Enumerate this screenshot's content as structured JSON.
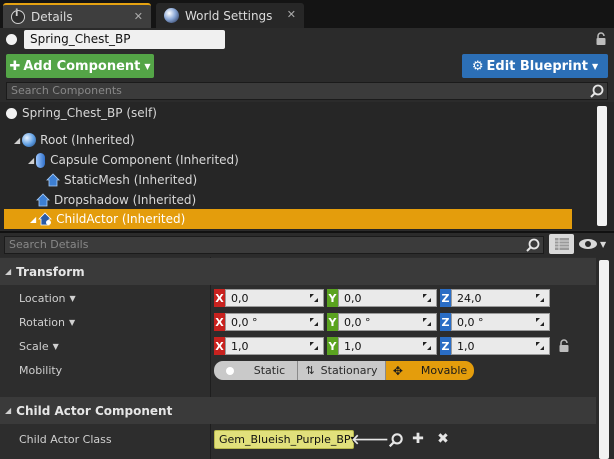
{
  "tabs": [
    {
      "label": "Details",
      "icon": "details-icon",
      "active": true
    },
    {
      "label": "World Settings",
      "icon": "globe-icon",
      "active": false
    }
  ],
  "actor": {
    "name": "Spring_Chest_BP"
  },
  "toolbar": {
    "add_component": "Add Component",
    "edit_blueprint": "Edit Blueprint"
  },
  "component_search": {
    "placeholder": "Search Components"
  },
  "components": [
    {
      "label": "Spring_Chest_BP (self)"
    },
    {
      "label": "Root (Inherited)"
    },
    {
      "label": "Capsule Component (Inherited)"
    },
    {
      "label": "StaticMesh (Inherited)"
    },
    {
      "label": "Dropshadow (Inherited)"
    },
    {
      "label": "ChildActor (Inherited)",
      "selected": true
    }
  ],
  "details_search": {
    "placeholder": "Search Details"
  },
  "transform": {
    "title": "Transform",
    "location": {
      "label": "Location",
      "x": "0,0",
      "y": "0,0",
      "z": "24,0"
    },
    "rotation": {
      "label": "Rotation",
      "x": "0,0 °",
      "y": "0,0 °",
      "z": "0,0 °"
    },
    "scale": {
      "label": "Scale",
      "x": "1,0",
      "y": "1,0",
      "z": "1,0"
    },
    "mobility": {
      "label": "Mobility",
      "options": [
        "Static",
        "Stationary",
        "Movable"
      ],
      "selected": "Movable"
    }
  },
  "axis_letters": {
    "x": "X",
    "y": "Y",
    "z": "Z"
  },
  "child_actor": {
    "title": "Child Actor Component",
    "class_label": "Child Actor Class",
    "class_value": "Gem_Blueish_Purple_BP"
  },
  "colors": {
    "accent": "#e49d0c",
    "add_button": "#54a547",
    "edit_button": "#2c6fb6",
    "axis_x": "#c8221f",
    "axis_y": "#5aa320",
    "axis_z": "#2a6dc5",
    "class_picker": "#e1e07b"
  }
}
